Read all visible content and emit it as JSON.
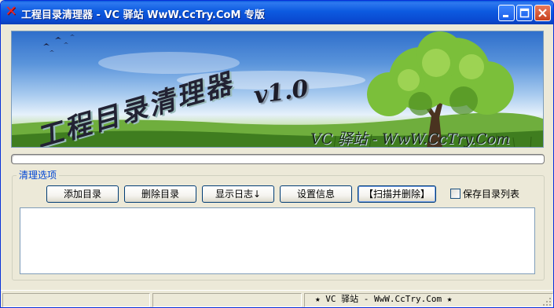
{
  "window": {
    "title": "工程目录清理器 - VC 驿站 WwW.CcTry.CoM 专版",
    "app_icon": "red-x-icon",
    "controls": [
      "minimize-icon",
      "maximize-icon",
      "close-icon"
    ]
  },
  "banner": {
    "title": "工程目录清理器",
    "version": "v1.0",
    "site": "VC 驿站 - WwW.CcTry.Com"
  },
  "progress": {
    "value": 0
  },
  "options_group": {
    "label": "清理选项",
    "buttons": {
      "add_dir": "添加目录",
      "delete_dir": "删除目录",
      "show_log": "显示日志↓",
      "settings": "设置信息",
      "scan_delete": "【扫描并删除】"
    },
    "save_list_checkbox": {
      "label": "保存目录列表",
      "checked": false
    }
  },
  "log": {
    "lines": []
  },
  "statusbar": {
    "text": "★  VC 驿站 -  WwW.CcTry.Com  ★"
  },
  "colors": {
    "titlebar": "#0a5bde",
    "group_label": "#0046d5",
    "window_bg": "#ece9d8"
  }
}
